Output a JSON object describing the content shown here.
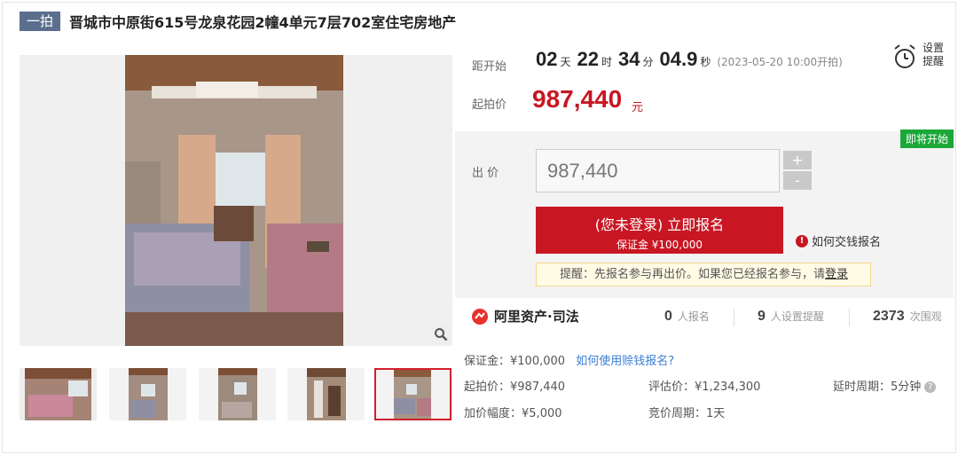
{
  "header": {
    "badge": "一拍",
    "title": "晋城市中原街615号龙泉花园2幢4单元7层702室住宅房地产"
  },
  "countdown": {
    "label": "距开始",
    "days": "02",
    "days_unit": "天",
    "hours": "22",
    "hours_unit": "时",
    "minutes": "34",
    "minutes_unit": "分",
    "seconds": "04.9",
    "seconds_unit": "秒",
    "start_time": "(2023-05-20 10:00开拍)"
  },
  "remind": {
    "line1": "设置",
    "line2": "提醒"
  },
  "start_price": {
    "label": "起拍价",
    "value": "987,440",
    "unit": "元"
  },
  "bid": {
    "status_tag": "即将开始",
    "label": "出 价",
    "input_value": "987,440",
    "plus": "+",
    "minus": "-",
    "signup_line1": "(您未登录) 立即报名",
    "signup_line2": "保证金 ¥100,000",
    "how_pay": "如何交钱报名",
    "notice_text": "提醒：先报名参与再出价。如果您已经报名参与，请",
    "notice_link": "登录"
  },
  "platform": {
    "name": "阿里资产·司法"
  },
  "stats": [
    {
      "value": "0",
      "label": "人报名"
    },
    {
      "value": "9",
      "label": "人设置提醒"
    },
    {
      "value": "2373",
      "label": "次围观"
    }
  ],
  "details": {
    "deposit_label": "保证金：",
    "deposit_value": "¥100,000",
    "deposit_link": "如何使用赊钱报名?",
    "start_price_label": "起拍价：",
    "start_price_value": "¥987,440",
    "appraisal_label": "评估价：",
    "appraisal_value": "¥1,234,300",
    "delay_label": "延时周期：",
    "delay_value": "5分钟",
    "increment_label": "加价幅度：",
    "increment_value": "¥5,000",
    "cycle_label": "竞价周期：",
    "cycle_value": "1天"
  },
  "colors": {
    "brand_red": "#c81623",
    "badge": "#5b6e8e",
    "green": "#1ba838",
    "link": "#3b7cd3"
  },
  "icons": [
    "alarm-clock-icon",
    "zoom-icon",
    "info-icon",
    "help-icon",
    "ali-logo-icon"
  ]
}
